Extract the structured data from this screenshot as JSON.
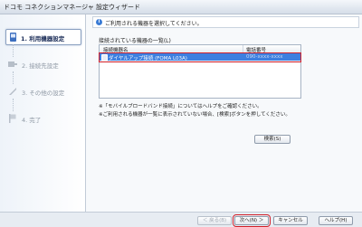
{
  "window": {
    "title": "ドコモ コネクションマネージャ 設定ウィザード"
  },
  "sidebar": {
    "steps": [
      {
        "label": "1. 利用機器設定",
        "icon": "device-icon",
        "active": true
      },
      {
        "label": "2. 接続先設定",
        "icon": "network-icon",
        "active": false
      },
      {
        "label": "3. その他の設定",
        "icon": "settings-icon",
        "active": false
      },
      {
        "label": "4. 完了",
        "icon": "flag-icon",
        "active": false
      }
    ]
  },
  "main": {
    "notice": "ご利用される機器を選択してください。",
    "list_heading": "接続されている機器の一覧(L)",
    "columns": [
      "接続機器名",
      "電話番号"
    ],
    "rows": [
      {
        "name": "ダイヤルアップ接続 (FOMA L03A)",
        "phone": "090-xxxx-xxxx",
        "selected": true
      }
    ],
    "notes": [
      "※「モバイルブロードバンド接続」についてはヘルプをご確認ください。",
      "※ご利用される機器が一覧に表示されていない場合、[検索]ボタンを押してください。"
    ],
    "search_button": "検索(S)"
  },
  "footer": {
    "back_button": "＜ 戻る(B)",
    "next_button": "次へ(N) ＞",
    "cancel_button": "キャンセル",
    "help_button": "ヘルプ(H)"
  },
  "colors": {
    "selection": "#3d7fe0",
    "highlight_frame": "#d2202a",
    "sidebar_active_text": "#1a2c57"
  }
}
